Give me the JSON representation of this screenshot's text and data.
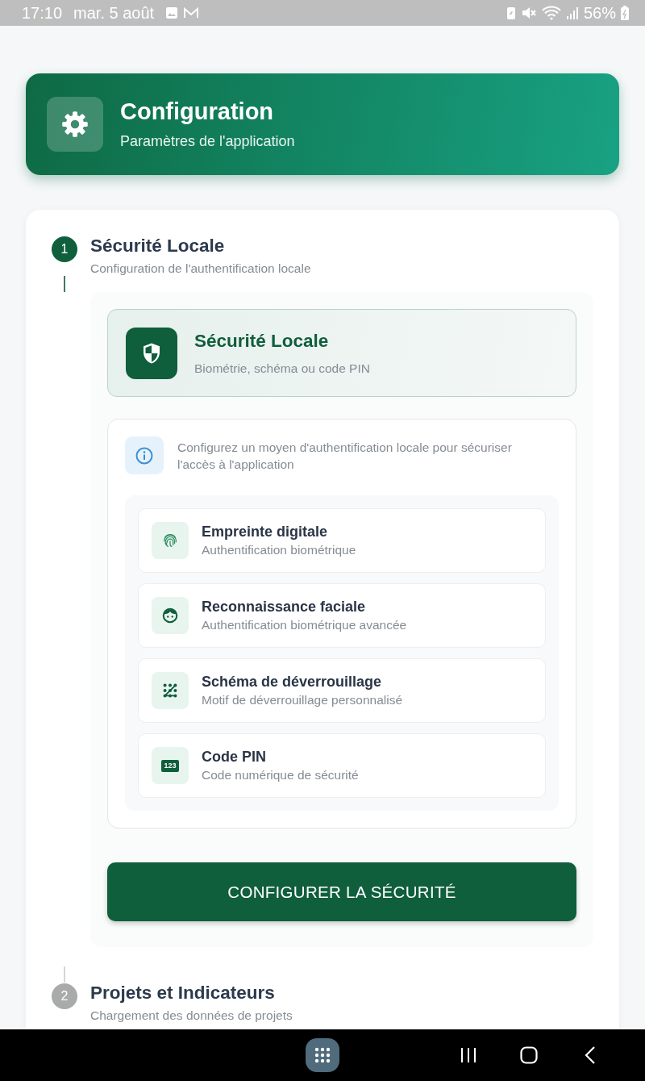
{
  "status_bar": {
    "time": "17:10",
    "date": "mar. 5 août",
    "battery": "56%"
  },
  "header": {
    "title": "Configuration",
    "subtitle": "Paramètres de l'application"
  },
  "steps": [
    {
      "number": "1",
      "title": "Sécurité Locale",
      "subtitle": "Configuration de l'authentification locale",
      "active": true,
      "content": {
        "option": {
          "title": "Sécurité Locale",
          "subtitle": "Biométrie, schéma ou code PIN",
          "selected": true
        },
        "info": "Configurez un moyen d'authentification locale pour sécuriser l'accès à l'application",
        "methods": [
          {
            "kind": "fingerprint",
            "title": "Empreinte digitale",
            "subtitle": "Authentification biométrique"
          },
          {
            "kind": "face",
            "title": "Reconnaissance faciale",
            "subtitle": "Authentification biométrique avancée"
          },
          {
            "kind": "pattern",
            "title": "Schéma de déverrouillage",
            "subtitle": "Motif de déverrouillage personnalisé"
          },
          {
            "kind": "pin",
            "title": "Code PIN",
            "subtitle": "Code numérique de sécurité",
            "icon_label": "123"
          }
        ],
        "button": "CONFIGURER LA SÉCURITÉ"
      }
    },
    {
      "number": "2",
      "title": "Projets et Indicateurs",
      "subtitle": "Chargement des données de projets",
      "active": false
    }
  ]
}
